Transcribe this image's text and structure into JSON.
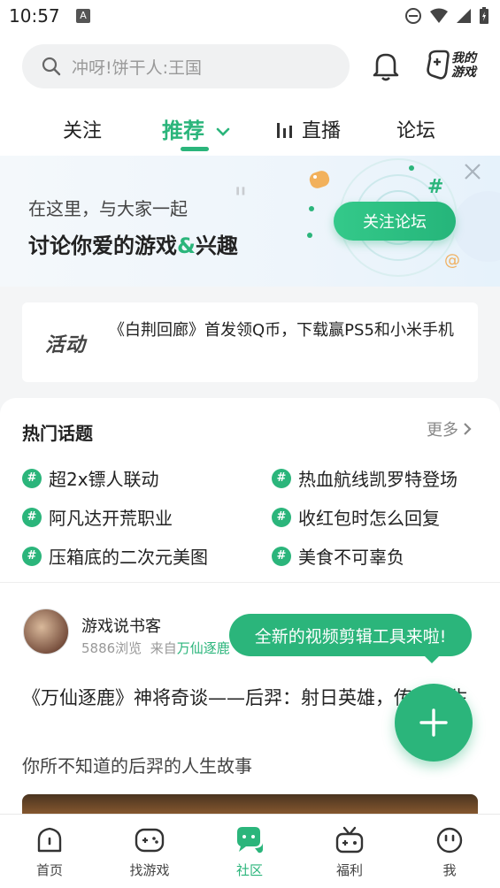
{
  "status_bar": {
    "time": "10:57",
    "notification_letter": "A"
  },
  "header": {
    "search_placeholder": "冲呀!饼干人:王国",
    "mygame_label_line1": "我的",
    "mygame_label_line2": "游戏"
  },
  "tabs": [
    {
      "label": "关注"
    },
    {
      "label": "推荐"
    },
    {
      "label": "直播"
    },
    {
      "label": "论坛"
    }
  ],
  "banner": {
    "line1": "在这里，与大家一起",
    "line2_a": "讨论你爱的游戏",
    "line2_amp": "&",
    "line2_b": "兴趣",
    "follow_button": "关注论坛"
  },
  "event": {
    "logo": "活动",
    "text": "《白荆回廊》首发领Q币，下载赢PS5和小米手机"
  },
  "hot_topics": {
    "title": "热门话题",
    "more": "更多",
    "items": [
      {
        "label": "超2x镖人联动"
      },
      {
        "label": "热血航线凯罗特登场"
      },
      {
        "label": "阿凡达开荒职业"
      },
      {
        "label": "收红包时怎么回复"
      },
      {
        "label": "压箱底的二次元美图"
      },
      {
        "label": "美食不可辜负"
      }
    ]
  },
  "post": {
    "author": "游戏说书客",
    "views": "5886浏览",
    "source_prefix": "来自",
    "source": "万仙逐鹿",
    "title": "《万仙逐鹿》神将奇谈——后羿：射日英雄，传奇人生",
    "subtitle": "你所不知道的后羿的人生故事"
  },
  "tooltip": "全新的视频剪辑工具来啦!",
  "bottom_nav": [
    {
      "label": "首页",
      "icon": "home-icon"
    },
    {
      "label": "找游戏",
      "icon": "gamepad-icon"
    },
    {
      "label": "社区",
      "icon": "chat-bubble-icon"
    },
    {
      "label": "福利",
      "icon": "gift-icon"
    },
    {
      "label": "我",
      "icon": "face-icon"
    }
  ],
  "colors": {
    "accent": "#2bb57b"
  }
}
